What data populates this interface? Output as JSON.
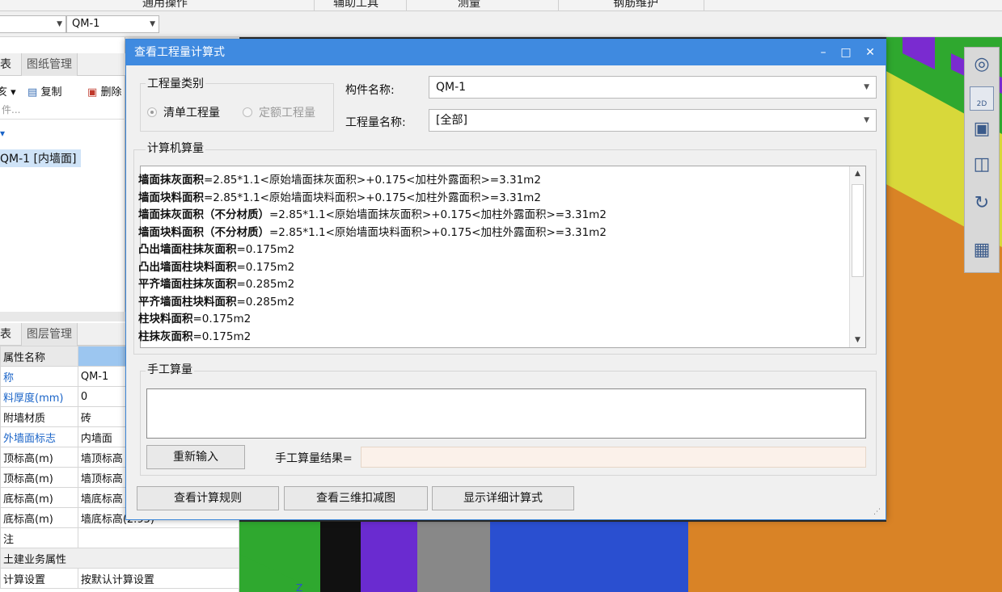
{
  "ribbon": {
    "tabs": [
      "通用操作",
      "辅助工具",
      "测量",
      "钢筋维护"
    ]
  },
  "selector": {
    "left_value": "",
    "component_value": "QM-1"
  },
  "left_panel": {
    "top_tabs": [
      "表",
      "图纸管理"
    ],
    "toolbar": {
      "copy": "复制",
      "delete": "删除"
    },
    "search_placeholder": "件...",
    "tree_selected": "QM-1 [内墙面]",
    "bottom_tabs": [
      "表",
      "图层管理"
    ],
    "prop_header": "属性名称",
    "props": [
      {
        "name": "称",
        "value": "QM-1",
        "blue": true
      },
      {
        "name": "料厚度(mm)",
        "value": "0",
        "blue": true
      },
      {
        "name": "附墙材质",
        "value": "砖",
        "blue": false
      },
      {
        "name": "外墙面标志",
        "value": "内墙面",
        "blue": true
      },
      {
        "name": "顶标高(m)",
        "value": "墙顶标高",
        "blue": false
      },
      {
        "name": "顶标高(m)",
        "value": "墙顶标高",
        "blue": false
      },
      {
        "name": "底标高(m)",
        "value": "墙底标高",
        "blue": false
      },
      {
        "name": "底标高(m)",
        "value": "墙底标高(2.95)",
        "blue": false
      },
      {
        "name": "注",
        "value": "",
        "blue": false
      }
    ],
    "group_label": "土建业务属性",
    "last_row": {
      "name": "计算设置",
      "value": "按默认计算设置"
    }
  },
  "dialog": {
    "title": "查看工程量计算式",
    "controls": {
      "minimize": "–",
      "maximize": "□",
      "close": "✕"
    },
    "qty_type_legend": "工程量类别",
    "radio_list": "清单工程量",
    "radio_quota": "定额工程量",
    "component_name_label": "构件名称:",
    "component_name_value": "QM-1",
    "qty_name_label": "工程量名称:",
    "qty_name_value": "[全部]",
    "computer_legend": "计算机算量",
    "calc_lines": [
      {
        "name": "墙面抹灰面积",
        "expr": "=2.85*1.1<原始墙面抹灰面积>+0.175<加柱外露面积>=3.31m2"
      },
      {
        "name": "墙面块料面积",
        "expr": "=2.85*1.1<原始墙面块料面积>+0.175<加柱外露面积>=3.31m2"
      },
      {
        "name": "墙面抹灰面积（不分材质）",
        "expr": "=2.85*1.1<原始墙面抹灰面积>+0.175<加柱外露面积>=3.31m2"
      },
      {
        "name": "墙面块料面积（不分材质）",
        "expr": "=2.85*1.1<原始墙面块料面积>+0.175<加柱外露面积>=3.31m2"
      },
      {
        "name": "凸出墙面柱抹灰面积",
        "expr": "=0.175m2"
      },
      {
        "name": "凸出墙面柱块料面积",
        "expr": "=0.175m2"
      },
      {
        "name": "平齐墙面柱抹灰面积",
        "expr": "=0.285m2"
      },
      {
        "name": "平齐墙面柱块料面积",
        "expr": "=0.285m2"
      },
      {
        "name": "柱块料面积",
        "expr": "=0.175m2"
      },
      {
        "name": "柱抹灰面积",
        "expr": "=0.175m2"
      }
    ],
    "manual_legend": "手工算量",
    "reenter_button": "重新输入",
    "manual_result_label": "手工算量结果=",
    "manual_result_value": "",
    "btn_rules": "查看计算规则",
    "btn_3d": "查看三维扣减图",
    "btn_detail": "显示详细计算式"
  },
  "viewport_tool": {
    "view_2d_label": "2D",
    "axis_label": "Z"
  }
}
